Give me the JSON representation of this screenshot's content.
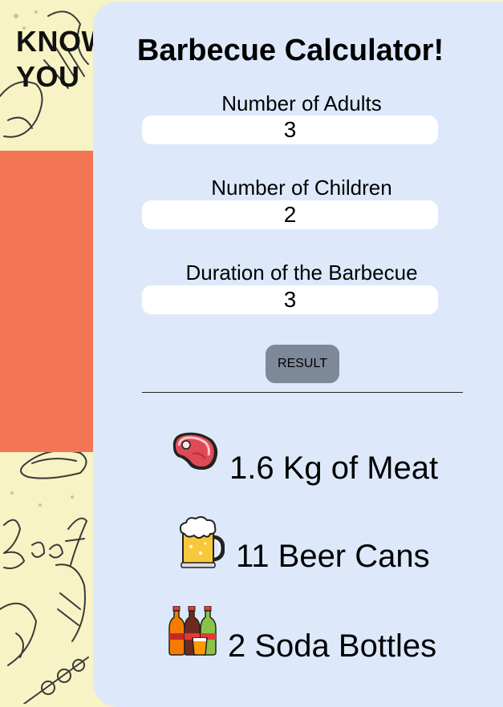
{
  "background": {
    "heading_line1": "KNOW",
    "heading_line2": "YOU",
    "doodle_word": "Beef"
  },
  "calculator": {
    "title": "Barbecue Calculator!",
    "fields": [
      {
        "label": "Number of Adults",
        "value": "3"
      },
      {
        "label": "Number of Children",
        "value": "2"
      },
      {
        "label": "Duration of the Barbecue",
        "value": "3"
      }
    ],
    "button_label": "RESULT",
    "results": [
      {
        "icon": "meat-steak-icon",
        "text": "1.6 Kg of Meat"
      },
      {
        "icon": "beer-mug-icon",
        "text": "11 Beer Cans"
      },
      {
        "icon": "soda-bottles-icon",
        "text": "2 Soda Bottles"
      }
    ]
  },
  "colors": {
    "page_background": "#f8f3c4",
    "card_background": "#dde9fb",
    "accent_panel": "#f47556",
    "button": "#7d8898"
  }
}
